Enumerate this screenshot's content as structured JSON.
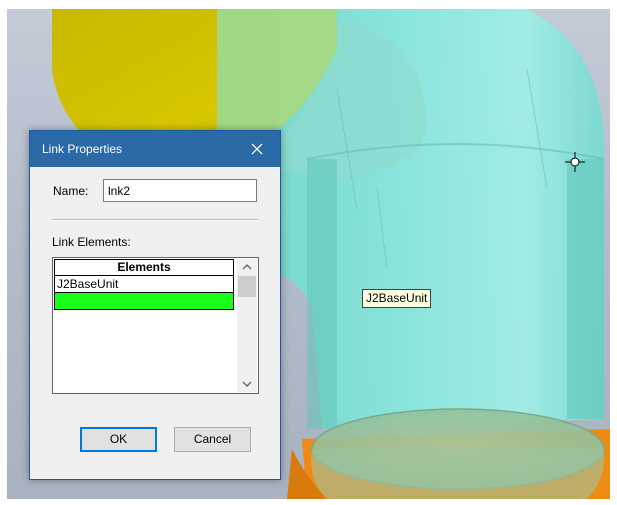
{
  "viewport": {
    "tooltip": "J2BaseUnit",
    "colors": {
      "background": "#b7c0cc",
      "link_body": "#7fe0d6",
      "upper_part": "#d4c200",
      "lower_part": "#ef8a12"
    }
  },
  "dialog": {
    "title": "Link Properties",
    "close_icon": "close-icon",
    "name_label": "Name:",
    "name_value": "lnk2",
    "elements_label": "Link Elements:",
    "grid": {
      "header": "Elements",
      "rows": [
        {
          "value": "J2BaseUnit",
          "highlight": false
        },
        {
          "value": "",
          "highlight": true,
          "color": "#19ff19"
        }
      ]
    },
    "ok_label": "OK",
    "cancel_label": "Cancel",
    "colors": {
      "titlebar": "#2a6aa6",
      "body": "#f0f0f0"
    }
  }
}
